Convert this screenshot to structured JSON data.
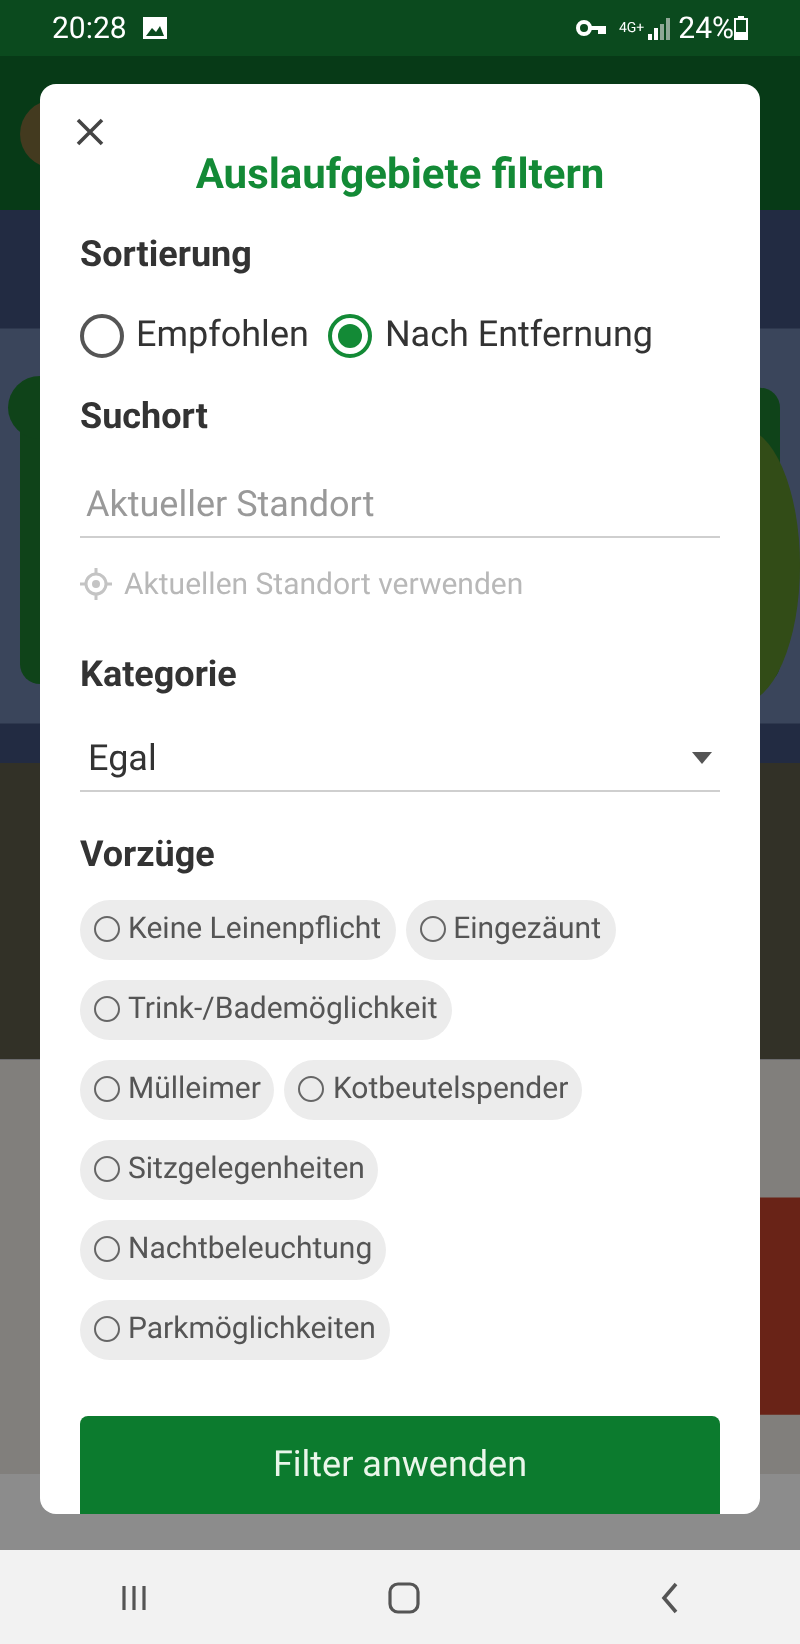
{
  "status_bar": {
    "time": "20:28",
    "network": "4G+",
    "battery": "24%"
  },
  "dialog": {
    "title": "Auslaufgebiete filtern",
    "sort": {
      "heading": "Sortierung",
      "options": [
        {
          "label": "Empfohlen",
          "selected": false
        },
        {
          "label": "Nach Entfernung",
          "selected": true
        }
      ]
    },
    "location": {
      "heading": "Suchort",
      "placeholder": "Aktueller Standort",
      "use_current": "Aktuellen Standort verwenden"
    },
    "category": {
      "heading": "Kategorie",
      "value": "Egal"
    },
    "features": {
      "heading": "Vorzüge",
      "rows": [
        [
          {
            "label": "Keine Leinenpflicht",
            "checked": false
          },
          {
            "label": "Eingezäunt",
            "checked": false
          }
        ],
        [
          {
            "label": "Trink-/Bademöglichkeit",
            "checked": false
          }
        ],
        [
          {
            "label": "Mülleimer",
            "checked": false
          },
          {
            "label": "Kotbeutelspender",
            "checked": false
          }
        ],
        [
          {
            "label": "Sitzgelegenheiten",
            "checked": false
          }
        ],
        [
          {
            "label": "Nachtbeleuchtung",
            "checked": false
          }
        ],
        [
          {
            "label": "Parkmöglichkeiten",
            "checked": false
          }
        ]
      ]
    },
    "apply_button": "Filter anwenden"
  }
}
